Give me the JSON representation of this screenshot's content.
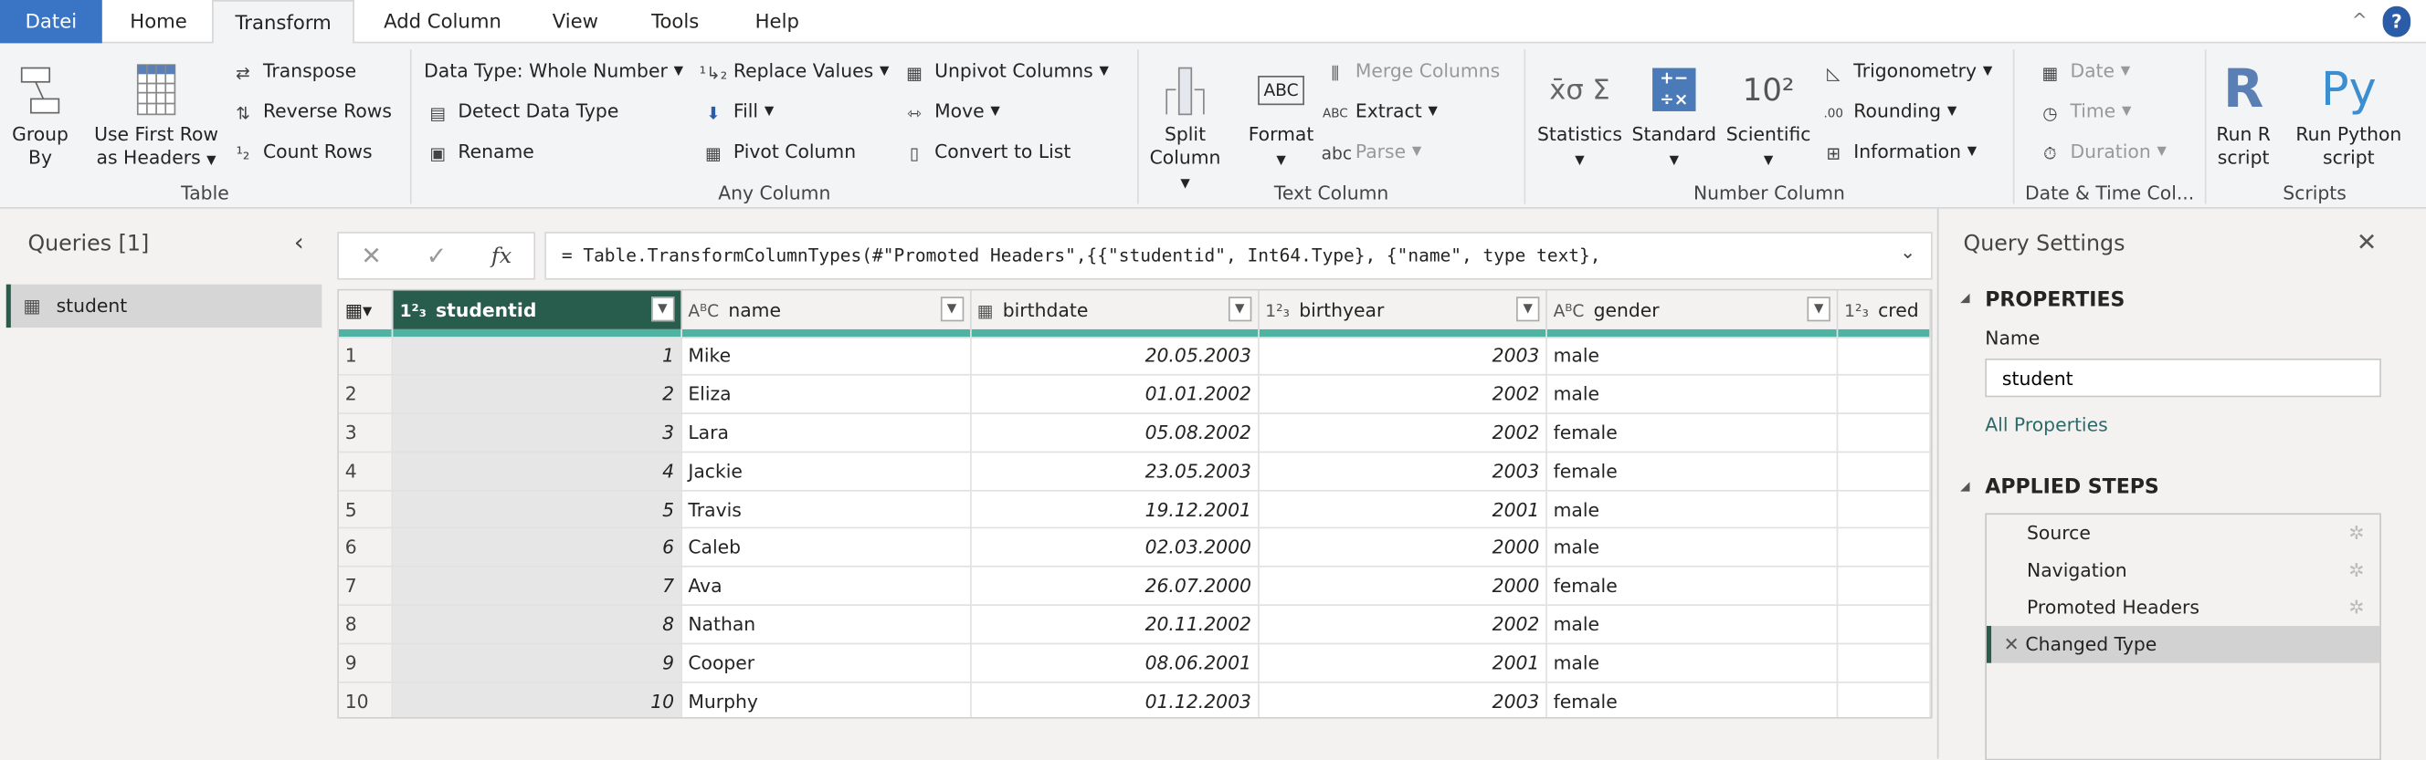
{
  "tabs": [
    "Datei",
    "Home",
    "Transform",
    "Add Column",
    "View",
    "Tools",
    "Help"
  ],
  "ribbon": {
    "table": {
      "label": "Table",
      "group_by": "Group By",
      "use_first_row": "Use First Row as Headers",
      "transpose": "Transpose",
      "reverse_rows": "Reverse Rows",
      "count_rows": "Count Rows"
    },
    "any_column": {
      "label": "Any Column",
      "data_type": "Data Type: Whole Number",
      "detect": "Detect Data Type",
      "rename": "Rename",
      "replace": "Replace Values",
      "fill": "Fill",
      "pivot": "Pivot Column",
      "unpivot": "Unpivot Columns",
      "move": "Move",
      "convert": "Convert to List"
    },
    "text_column": {
      "label": "Text Column",
      "split": "Split Column",
      "format": "Format",
      "merge": "Merge Columns",
      "extract": "Extract",
      "parse": "Parse"
    },
    "number_column": {
      "label": "Number Column",
      "statistics": "Statistics",
      "standard": "Standard",
      "scientific": "Scientific",
      "trig": "Trigonometry",
      "rounding": "Rounding",
      "information": "Information"
    },
    "datetime": {
      "label": "Date & Time Col...",
      "date": "Date",
      "time": "Time",
      "duration": "Duration"
    },
    "scripts": {
      "label": "Scripts",
      "r": "Run R script",
      "py": "Run Python script"
    }
  },
  "queries": {
    "title": "Queries [1]",
    "items": [
      "student"
    ]
  },
  "formula": {
    "text": "= Table.TransformColumnTypes(#\"Promoted Headers\",{{\"studentid\", Int64.Type}, {\"name\", type text},"
  },
  "grid": {
    "columns": [
      {
        "type": "1²₃",
        "name": "studentid"
      },
      {
        "type": "AᴮC",
        "name": "name"
      },
      {
        "type": "▦",
        "name": "birthdate"
      },
      {
        "type": "1²₃",
        "name": "birthyear"
      },
      {
        "type": "AᴮC",
        "name": "gender"
      },
      {
        "type": "1²₃",
        "name": "cred"
      }
    ],
    "rows": [
      [
        "1",
        "Mike",
        "20.05.2003",
        "2003",
        "male"
      ],
      [
        "2",
        "Eliza",
        "01.01.2002",
        "2002",
        "male"
      ],
      [
        "3",
        "Lara",
        "05.08.2002",
        "2002",
        "female"
      ],
      [
        "4",
        "Jackie",
        "23.05.2003",
        "2003",
        "female"
      ],
      [
        "5",
        "Travis",
        "19.12.2001",
        "2001",
        "male"
      ],
      [
        "6",
        "Caleb",
        "02.03.2000",
        "2000",
        "male"
      ],
      [
        "7",
        "Ava",
        "26.07.2000",
        "2000",
        "female"
      ],
      [
        "8",
        "Nathan",
        "20.11.2002",
        "2002",
        "male"
      ],
      [
        "9",
        "Cooper",
        "08.06.2001",
        "2001",
        "male"
      ],
      [
        "10",
        "Murphy",
        "01.12.2003",
        "2003",
        "female"
      ]
    ]
  },
  "settings": {
    "title": "Query Settings",
    "properties": "PROPERTIES",
    "name_label": "Name",
    "name_value": "student",
    "all_props": "All Properties",
    "applied": "APPLIED STEPS",
    "steps": [
      "Source",
      "Navigation",
      "Promoted Headers",
      "Changed Type"
    ]
  }
}
